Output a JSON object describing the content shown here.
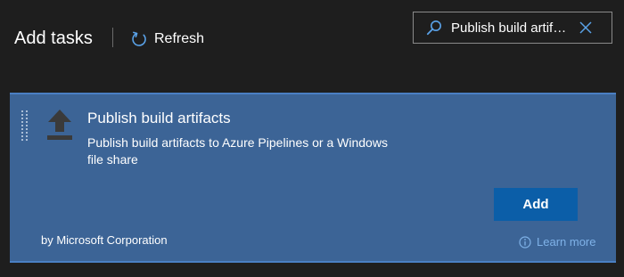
{
  "header": {
    "title": "Add tasks",
    "refresh_label": "Refresh",
    "refresh_icon": "refresh-icon"
  },
  "search": {
    "value": "Publish build artifa…",
    "search_icon": "search-icon",
    "clear_icon": "close-icon"
  },
  "task": {
    "icon": "upload-arrow-icon",
    "title": "Publish build artifacts",
    "description": "Publish build artifacts to Azure Pipelines or a Windows file share",
    "add_label": "Add",
    "publisher": "by Microsoft Corporation",
    "learn_more_label": "Learn more"
  },
  "colors": {
    "background": "#1e1e1e",
    "card": "#3c6496",
    "card_border": "#4a7fc3",
    "primary_button": "#0b5ea8",
    "link": "#7fb2e8"
  }
}
